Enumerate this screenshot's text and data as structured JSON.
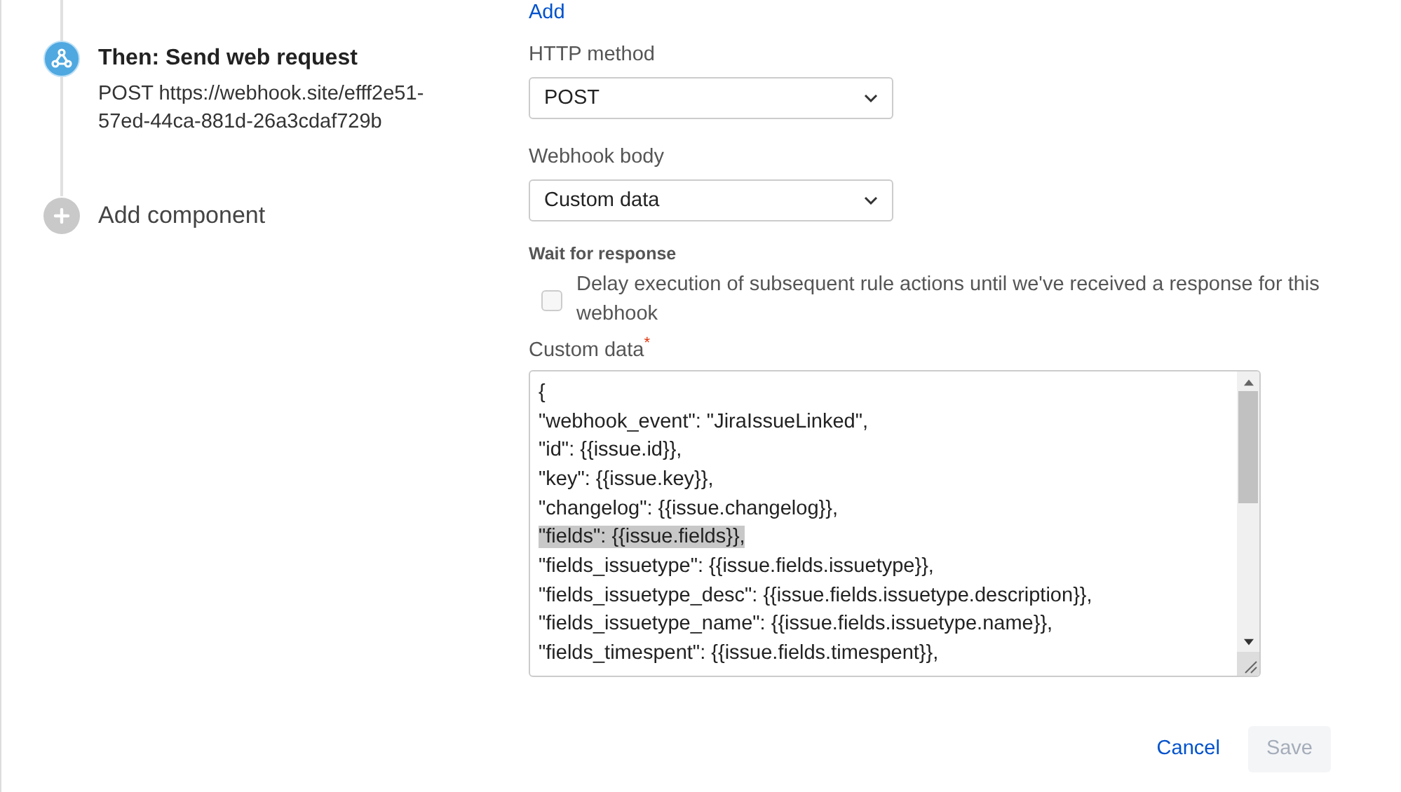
{
  "steps": [
    {
      "kind": "action",
      "title": "Then: Send web request",
      "detail": "POST https://webhook.site/efff2e51-57ed-44ca-881d-26a3cdaf729b"
    },
    {
      "kind": "add",
      "title": "Add component"
    }
  ],
  "form": {
    "add_link": "Add",
    "http_method": {
      "label": "HTTP method",
      "value": "POST"
    },
    "webhook_body": {
      "label": "Webhook body",
      "value": "Custom data"
    },
    "wait": {
      "heading": "Wait for response",
      "label": "Delay execution of subsequent rule actions until we've received a response for this webhook",
      "checked": false
    },
    "custom_data": {
      "label": "Custom data",
      "required_mark": "*",
      "lines": [
        {
          "text": "{",
          "selected": false
        },
        {
          "text": "\"webhook_event\": \"JiraIssueLinked\",",
          "selected": false
        },
        {
          "text": "\"id\": {{issue.id}},",
          "selected": false
        },
        {
          "text": "\"key\": {{issue.key}},",
          "selected": false
        },
        {
          "text": "\"changelog\": {{issue.changelog}},",
          "selected": false
        },
        {
          "text": "\"fields\": {{issue.fields}},",
          "selected": true
        },
        {
          "text": "\"fields_issuetype\": {{issue.fields.issuetype}},",
          "selected": false
        },
        {
          "text": "\"fields_issuetype_desc\": {{issue.fields.issuetype.description}},",
          "selected": false
        },
        {
          "text": "\"fields_issuetype_name\": {{issue.fields.issuetype.name}},",
          "selected": false
        },
        {
          "text": "\"fields_timespent\": {{issue.fields.timespent}},",
          "selected": false
        }
      ]
    },
    "buttons": [
      {
        "kind": "link",
        "label": "Cancel",
        "disabled": false
      },
      {
        "kind": "primary",
        "label": "Save",
        "disabled": true
      }
    ]
  }
}
